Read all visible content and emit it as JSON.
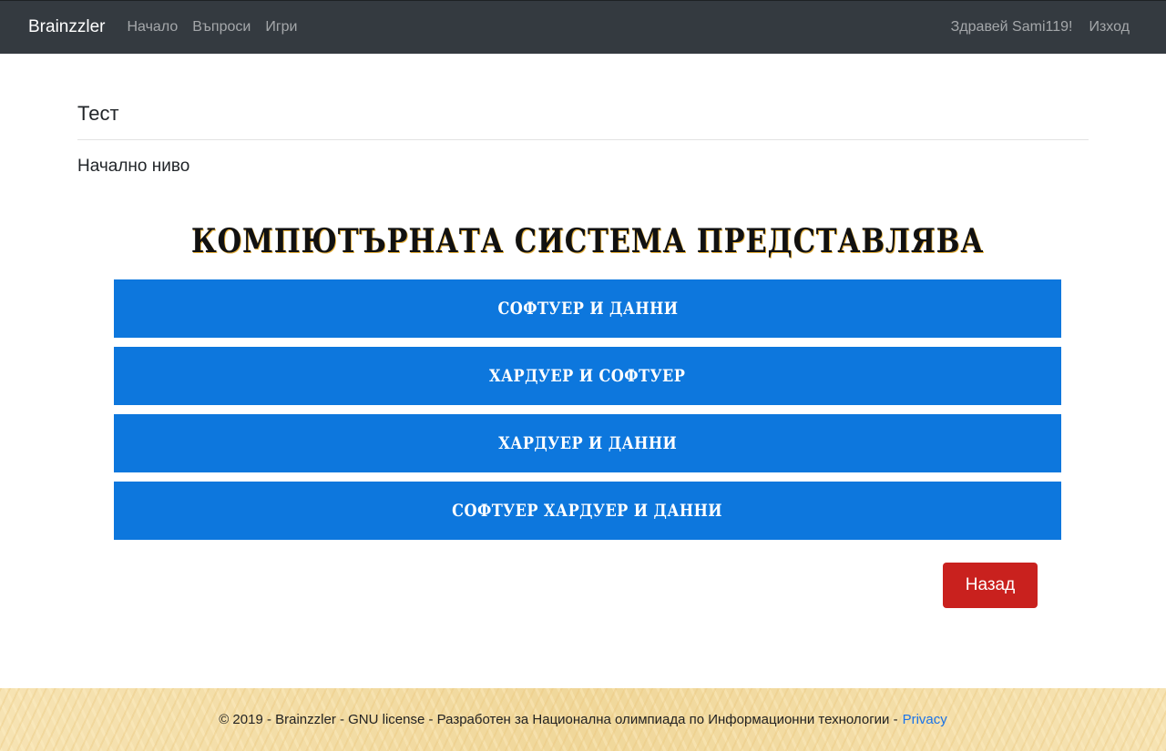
{
  "navbar": {
    "brand": "Brainzzler",
    "links": [
      "Начало",
      "Въпроси",
      "Игри"
    ],
    "greeting": "Здравей Sami119!",
    "logout": "Изход"
  },
  "page": {
    "title": "Тест",
    "level": "Начално ниво"
  },
  "quiz": {
    "question": "КОМПЮТЪРНАТА СИСТЕМА ПРЕДСТАВЛЯВА",
    "answers": [
      "СОФТУЕР И ДАННИ",
      "ХАРДУЕР И СОФТУЕР",
      "ХАРДУЕР И ДАННИ",
      "СОФТУЕР ХАРДУЕР И ДАННИ"
    ],
    "back_label": "Назад"
  },
  "footer": {
    "text": "© 2019 - Brainzzler - GNU license - Разработен за Национална олимпиада по Информационни технологии -",
    "privacy": "Privacy"
  },
  "colors": {
    "navbar": "#343a40",
    "answer": "#0d77dd",
    "back_button": "#c9211e",
    "link": "#1a73e8"
  }
}
